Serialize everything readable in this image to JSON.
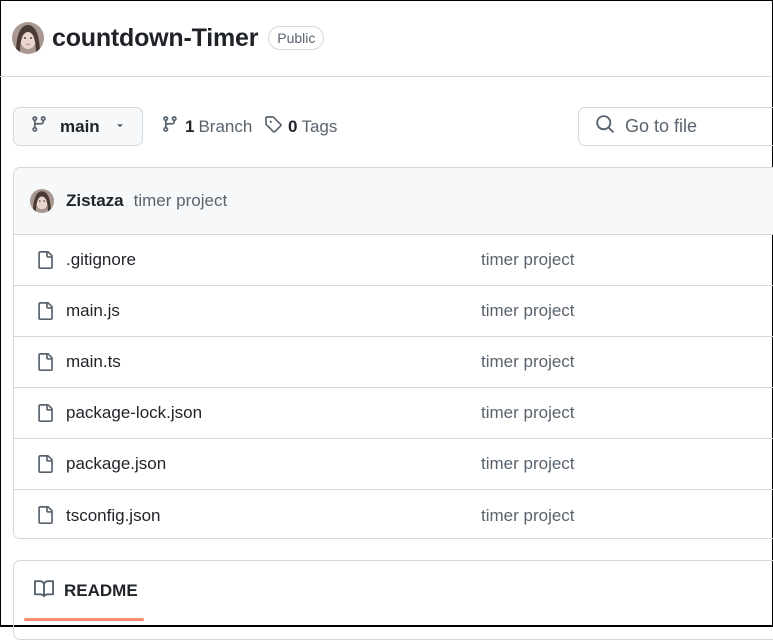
{
  "repo": {
    "name": "countdown-Timer",
    "visibility": "Public"
  },
  "toolbar": {
    "branch_name": "main",
    "branch_count": "1",
    "branch_label": "Branch",
    "tag_count": "0",
    "tag_label": "Tags",
    "goto_placeholder": "Go to file"
  },
  "latest_commit": {
    "author": "Zistaza",
    "message": "timer project"
  },
  "files": [
    {
      "name": ".gitignore",
      "commit": "timer project"
    },
    {
      "name": "main.js",
      "commit": "timer project"
    },
    {
      "name": "main.ts",
      "commit": "timer project"
    },
    {
      "name": "package-lock.json",
      "commit": "timer project"
    },
    {
      "name": "package.json",
      "commit": "timer project"
    },
    {
      "name": "tsconfig.json",
      "commit": "timer project"
    }
  ],
  "readme": {
    "tab_label": "README"
  },
  "colors": {
    "border": "#d1d9e0",
    "muted_text": "#59636e",
    "readme_underline": "#fd8c73"
  }
}
